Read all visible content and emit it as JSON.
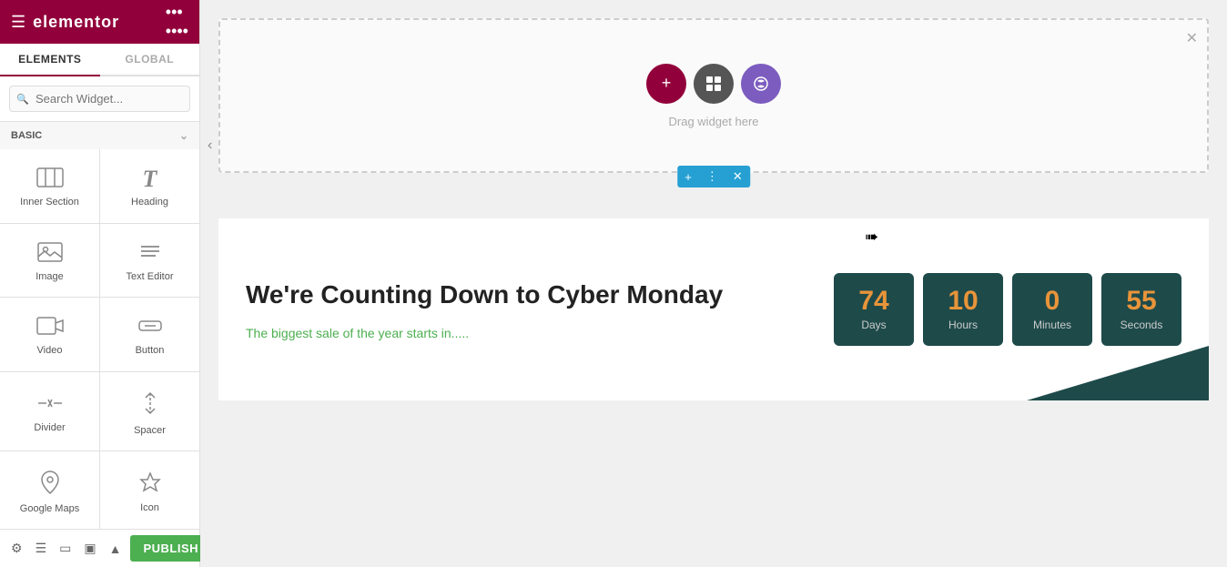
{
  "sidebar": {
    "logo": "elementor",
    "tabs": [
      {
        "id": "elements",
        "label": "ELEMENTS",
        "active": true
      },
      {
        "id": "global",
        "label": "GLOBAL",
        "active": false
      }
    ],
    "search": {
      "placeholder": "Search Widget..."
    },
    "sections": [
      {
        "id": "basic",
        "label": "BASIC",
        "widgets": [
          {
            "id": "inner-section",
            "label": "Inner Section",
            "icon": "lines"
          },
          {
            "id": "heading",
            "label": "Heading",
            "icon": "heading"
          },
          {
            "id": "image",
            "label": "Image",
            "icon": "image"
          },
          {
            "id": "text-editor",
            "label": "Text Editor",
            "icon": "text"
          },
          {
            "id": "video",
            "label": "Video",
            "icon": "video"
          },
          {
            "id": "button",
            "label": "Button",
            "icon": "button"
          },
          {
            "id": "divider",
            "label": "Divider",
            "icon": "divider"
          },
          {
            "id": "spacer",
            "label": "Spacer",
            "icon": "spacer"
          },
          {
            "id": "map",
            "label": "Google Maps",
            "icon": "map"
          },
          {
            "id": "icon",
            "label": "Icon",
            "icon": "star"
          }
        ]
      }
    ],
    "bottom_icons": [
      "settings",
      "layers",
      "navigator",
      "responsive",
      "preview"
    ],
    "publish_label": "PUBLISH"
  },
  "canvas": {
    "drag_text": "Drag widget here",
    "toolbar": {
      "add": "+",
      "layout": "⊞",
      "ai": "🤖"
    },
    "row_toolbar": {
      "add": "+",
      "move": "⠿",
      "close": "×"
    },
    "countdown": {
      "title": "We're Counting Down to Cyber Monday",
      "subtitle": "The biggest sale of the year starts in.....",
      "timer": [
        {
          "value": "74",
          "label": "Days"
        },
        {
          "value": "10",
          "label": "Hours"
        },
        {
          "value": "0",
          "label": "Minutes"
        },
        {
          "value": "55",
          "label": "Seconds"
        }
      ]
    }
  }
}
